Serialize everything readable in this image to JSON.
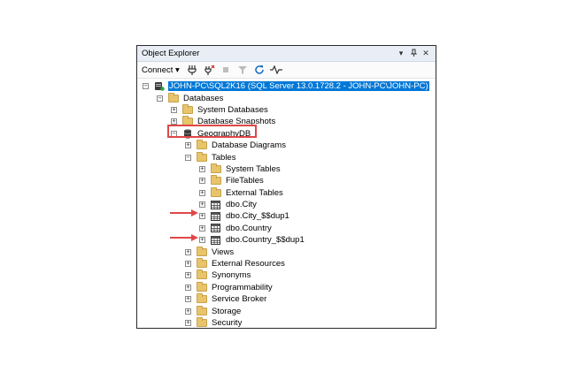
{
  "window": {
    "title": "Object Explorer",
    "pin_glyph": "▾",
    "dock_glyph": "⊥",
    "close_glyph": "✕"
  },
  "toolbar": {
    "connect_label": "Connect ▾",
    "icons": [
      "connect-icon",
      "disconnect-icon",
      "stop-icon",
      "filter-icon",
      "refresh-icon",
      "activity-monitor-icon"
    ]
  },
  "tree": {
    "server": "JOHN-PC\\SQL2K16 (SQL Server 13.0.1728.2 - JOHN-PC\\JOHN-PC)",
    "databases": "Databases",
    "system_databases": "System Databases",
    "database_snapshots": "Database Snapshots",
    "geography_db": "GeographyDB",
    "database_diagrams": "Database Diagrams",
    "tables": "Tables",
    "system_tables": "System Tables",
    "file_tables": "FileTables",
    "external_tables": "External Tables",
    "dbo_city": "dbo.City",
    "dbo_city_dup": "dbo.City_$$dup1",
    "dbo_country": "dbo.Country",
    "dbo_country_dup": "dbo.Country_$$dup1",
    "views": "Views",
    "external_resources": "External Resources",
    "synonyms": "Synonyms",
    "programmability": "Programmability",
    "service_broker": "Service Broker",
    "storage": "Storage",
    "security": "Security"
  },
  "colors": {
    "selection": "#0078d7",
    "highlight": "#e04848",
    "folder": "#e8c46b"
  }
}
